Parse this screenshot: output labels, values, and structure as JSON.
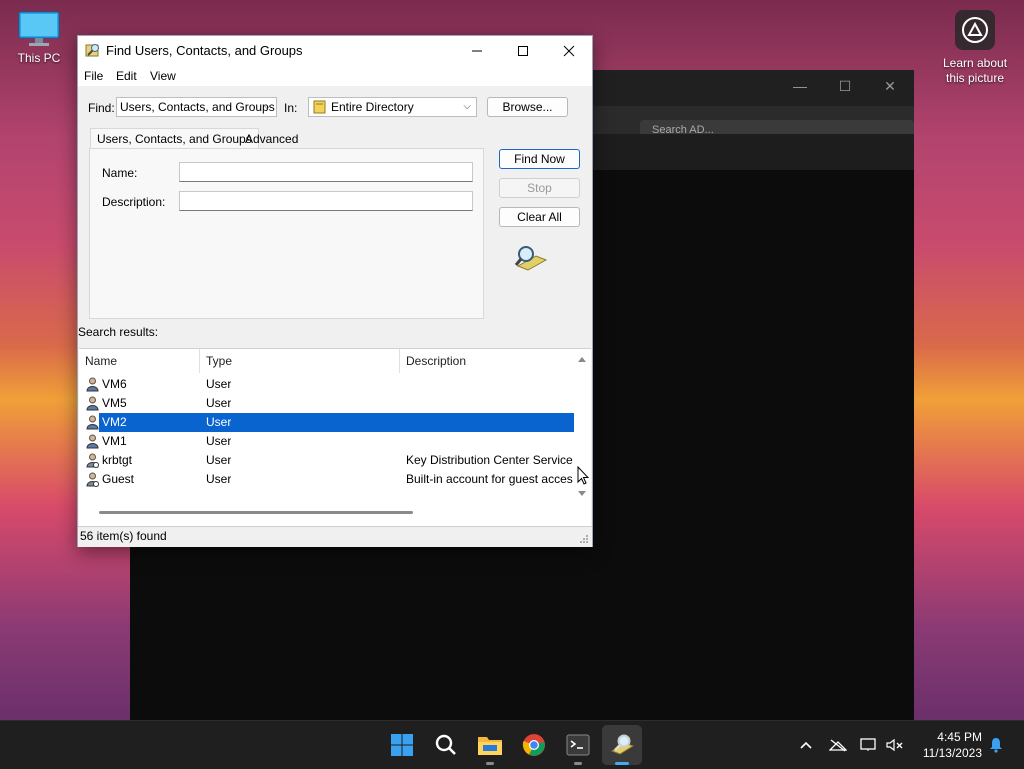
{
  "desktop": {
    "this_pc_label": "This PC",
    "learn_label": "Learn about this picture"
  },
  "background_window": {
    "search_placeholder": "Search AD..."
  },
  "dialog": {
    "title": "Find Users, Contacts, and Groups",
    "menu": [
      "File",
      "Edit",
      "View"
    ],
    "find_label": "Find:",
    "find_value": "Users, Contacts, and Groups",
    "in_label": "In:",
    "in_value": "Entire Directory",
    "browse_label": "Browse...",
    "tabs": [
      "Users, Contacts, and Groups",
      "Advanced"
    ],
    "name_label": "Name:",
    "name_value": "",
    "description_label": "Description:",
    "description_value": "",
    "find_now_label": "Find Now",
    "stop_label": "Stop",
    "clear_all_label": "Clear All",
    "search_results_label": "Search results:",
    "columns": [
      "Name",
      "Type",
      "Description"
    ],
    "rows": [
      {
        "name": "VM6",
        "type": "User",
        "description": ""
      },
      {
        "name": "VM5",
        "type": "User",
        "description": ""
      },
      {
        "name": "VM2",
        "type": "User",
        "description": ""
      },
      {
        "name": "VM1",
        "type": "User",
        "description": ""
      },
      {
        "name": "krbtgt",
        "type": "User",
        "description": "Key Distribution Center Service A"
      },
      {
        "name": "Guest",
        "type": "User",
        "description": "Built-in account for guest acces"
      }
    ],
    "selected_row": "VM2",
    "status": "56 item(s) found"
  },
  "taskbar": {
    "time": "4:45 PM",
    "date": "11/13/2023",
    "icons": [
      "start-icon",
      "search-icon",
      "file-explorer-icon",
      "chrome-icon",
      "terminal-icon",
      "find-users-icon"
    ]
  },
  "colors": {
    "selection": "#0a64d0",
    "primary_border": "#1e66c4",
    "taskbar": "#1f1f1f"
  }
}
